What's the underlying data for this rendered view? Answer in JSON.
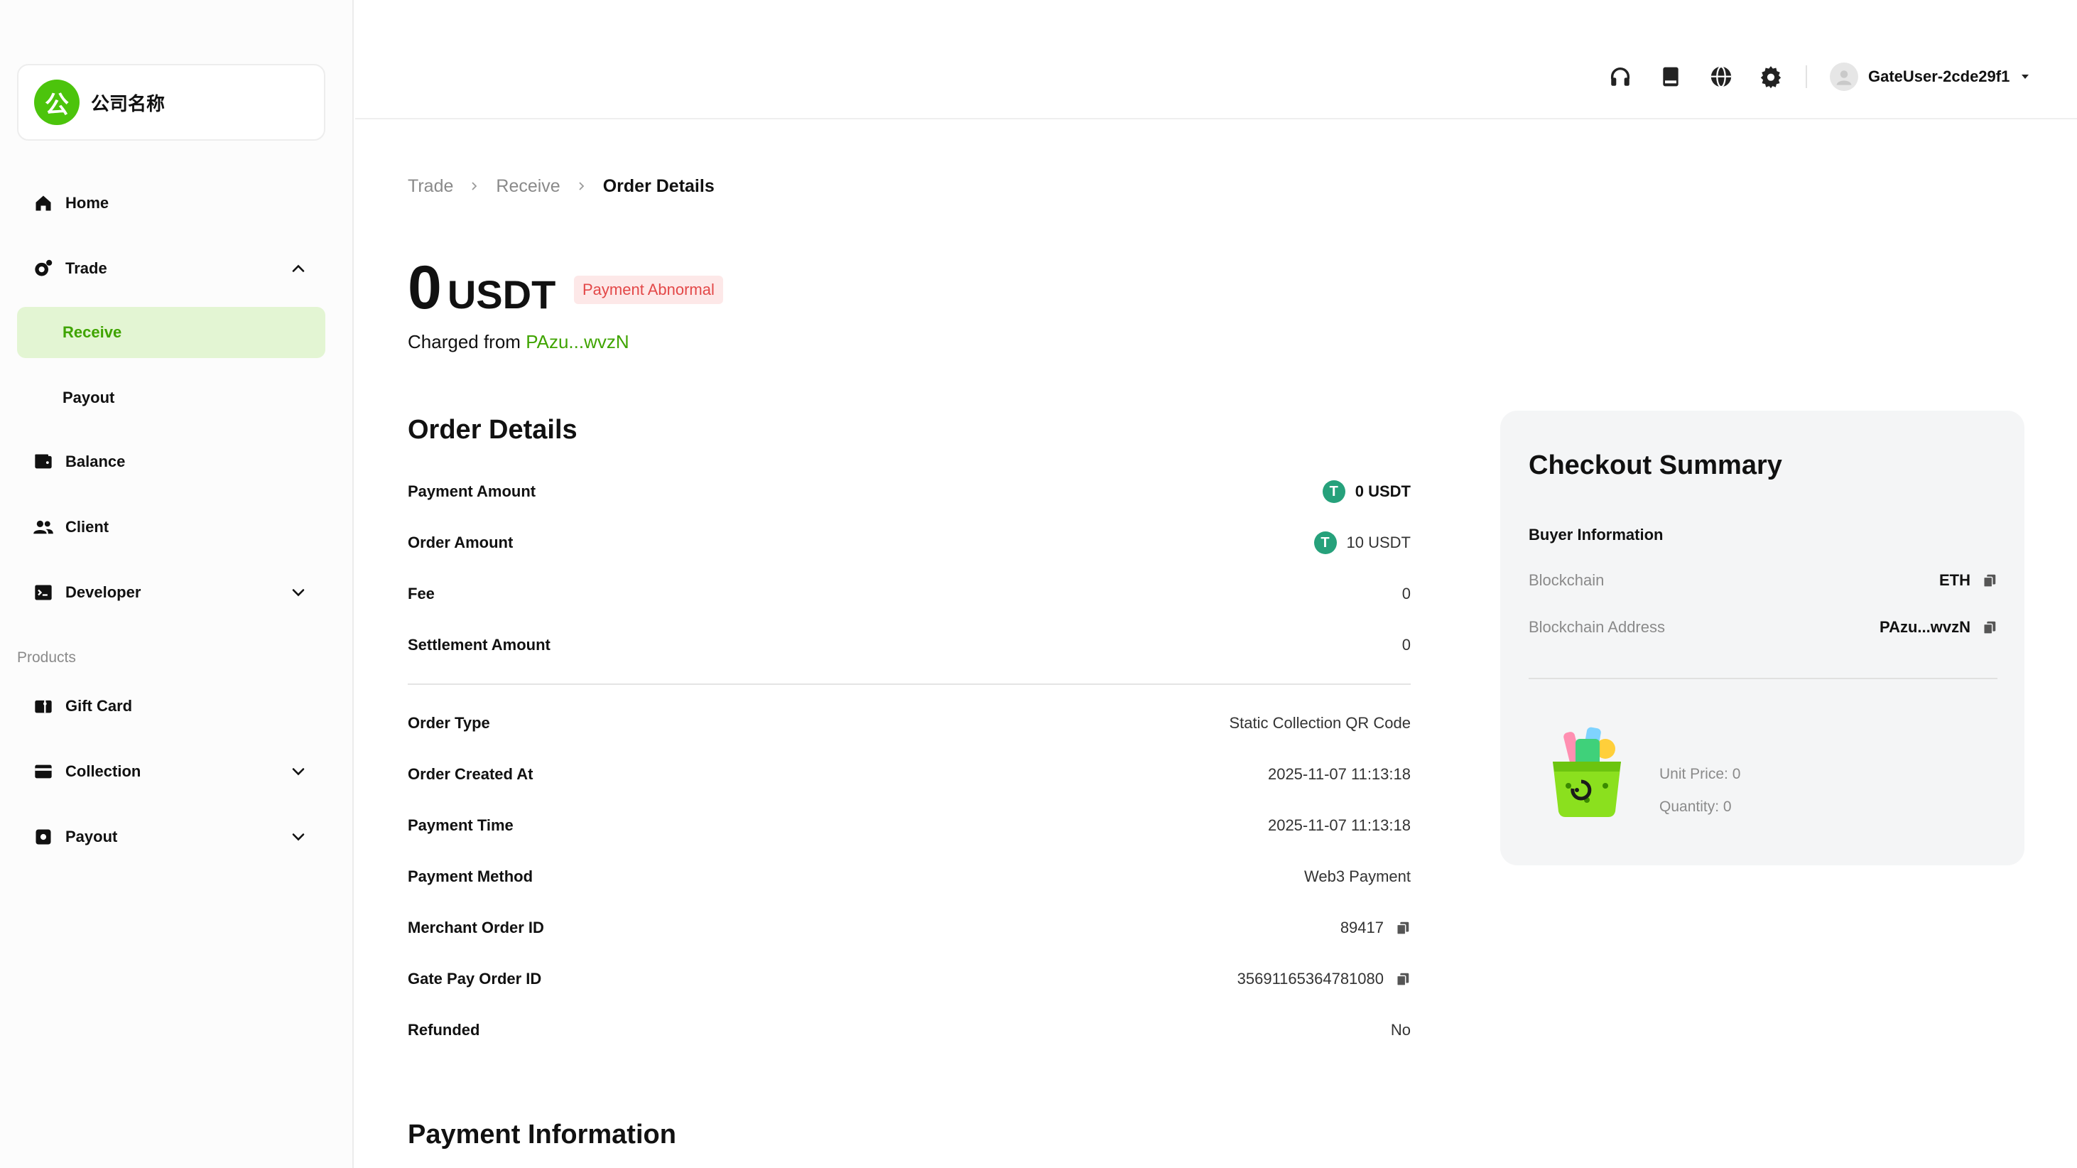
{
  "brand": {
    "logo_char": "公",
    "name": "公司名称"
  },
  "sidebar": {
    "home": "Home",
    "trade": "Trade",
    "receive": "Receive",
    "payout_sub": "Payout",
    "balance": "Balance",
    "client": "Client",
    "developer": "Developer",
    "products_section": "Products",
    "gift_card": "Gift Card",
    "collection": "Collection",
    "payout": "Payout"
  },
  "topbar": {
    "user_name": "GateUser-2cde29f1"
  },
  "breadcrumb": [
    "Trade",
    "Receive",
    "Order Details"
  ],
  "header": {
    "amount": "0",
    "currency": "USDT",
    "status": "Payment Abnormal",
    "charged_prefix": "Charged from",
    "charged_address": "PAzu...wvzN"
  },
  "order_details": {
    "title": "Order Details",
    "rows": [
      {
        "label": "Payment Amount",
        "value": "0 USDT"
      },
      {
        "label": "Order Amount",
        "value": "10 USDT"
      },
      {
        "label": "Fee",
        "value": "0"
      },
      {
        "label": "Settlement Amount",
        "value": "0"
      },
      {
        "label": "Order Type",
        "value": "Static Collection QR Code"
      },
      {
        "label": "Order Created At",
        "value": "2025-11-07 11:13:18"
      },
      {
        "label": "Payment Time",
        "value": "2025-11-07 11:13:18"
      },
      {
        "label": "Payment Method",
        "value": "Web3 Payment"
      },
      {
        "label": "Merchant Order ID",
        "value": "89417"
      },
      {
        "label": "Gate Pay Order ID",
        "value": "35691165364781080"
      },
      {
        "label": "Refunded",
        "value": "No"
      }
    ]
  },
  "payment_information": {
    "title": "Payment Information"
  },
  "checkout": {
    "title": "Checkout Summary",
    "buyer_info": "Buyer Information",
    "blockchain_label": "Blockchain",
    "blockchain_value": "ETH",
    "address_label": "Blockchain Address",
    "address_value": "PAzu...wvzN",
    "unit_price": "Unit Price: 0",
    "quantity": "Quantity: 0"
  },
  "colors": {
    "accent": "#3fa400",
    "active_bg": "#e3f5d3",
    "danger": "#e34848",
    "tether": "#26a17b"
  },
  "icons": [
    "headset-icon",
    "book-icon",
    "globe-icon",
    "gear-icon",
    "user-avatar-icon",
    "caret-down-icon",
    "home-icon",
    "trade-icon",
    "wallet-icon",
    "users-icon",
    "terminal-icon",
    "gift-card-icon",
    "card-icon",
    "payout-icon",
    "copy-icon",
    "tether-icon",
    "chevron-up-icon",
    "chevron-down-icon"
  ]
}
